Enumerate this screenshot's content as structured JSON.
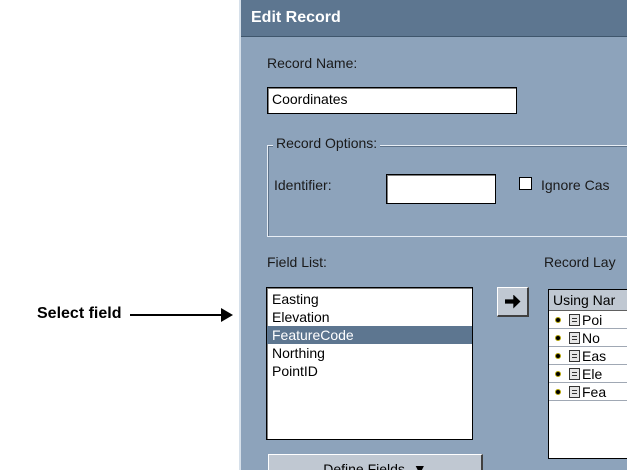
{
  "annotation": {
    "label": "Select field"
  },
  "dialog": {
    "title": "Edit Record",
    "record_name": {
      "label": "Record Name:",
      "value": "Coordinates"
    },
    "record_options": {
      "title": "Record Options:",
      "identifier_label": "Identifier:",
      "identifier_value": "",
      "ignore_case_label": "Ignore Cas"
    },
    "field_list": {
      "label": "Field List:",
      "items": [
        "Easting",
        "Elevation",
        "FeatureCode",
        "Northing",
        "PointID"
      ],
      "selected": "FeatureCode"
    },
    "define_fields": {
      "prefix": "Define ",
      "mnemonic": "F",
      "suffix": "ields",
      "arrow": "▼"
    },
    "record_layout": {
      "label": "Record Lay",
      "header": "Using Nar",
      "rows": [
        "Poi",
        "No",
        "Eas",
        "Ele",
        "Fea"
      ]
    }
  }
}
